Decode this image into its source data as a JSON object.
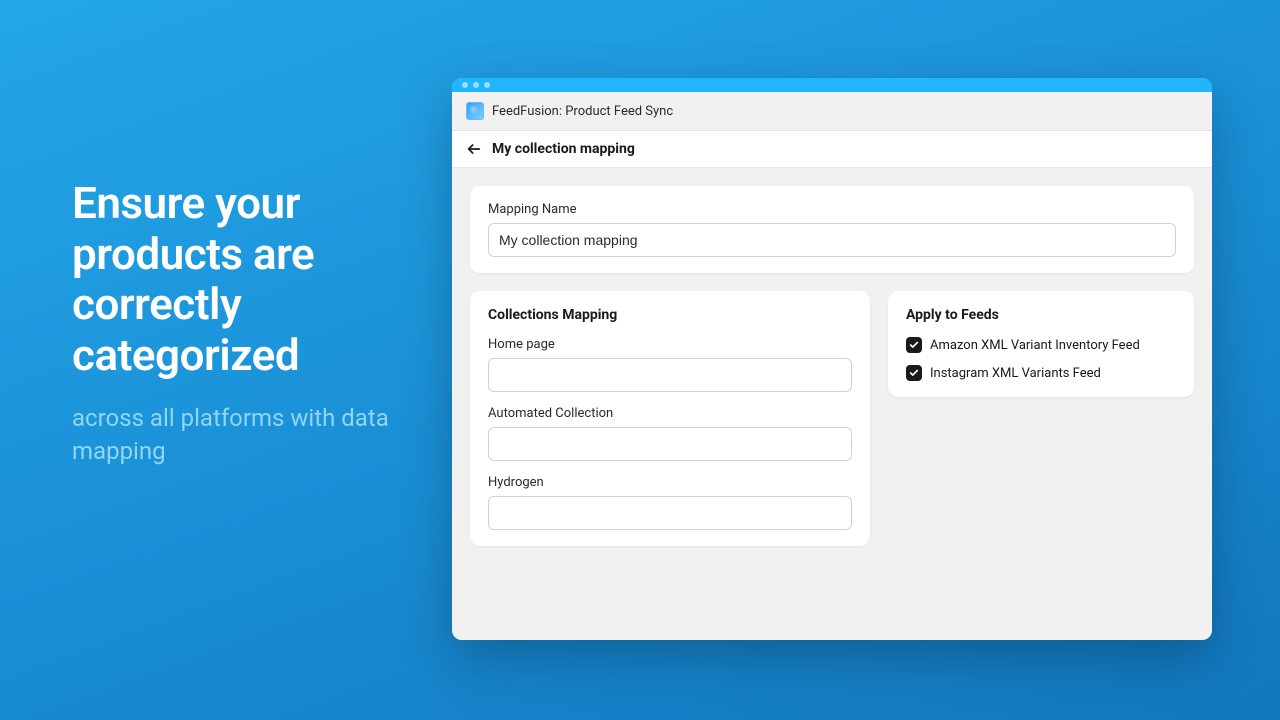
{
  "marketing": {
    "headline": "Ensure your products are correctly categorized",
    "subline": "across all platforms with data mapping"
  },
  "app": {
    "title": "FeedFusion: Product Feed Sync"
  },
  "page": {
    "title": "My collection mapping"
  },
  "mapping_name": {
    "label": "Mapping Name",
    "value": "My collection mapping"
  },
  "collections": {
    "title": "Collections Mapping",
    "items": [
      {
        "label": "Home page",
        "value": ""
      },
      {
        "label": "Automated Collection",
        "value": ""
      },
      {
        "label": "Hydrogen",
        "value": ""
      }
    ]
  },
  "feeds": {
    "title": "Apply to Feeds",
    "items": [
      {
        "label": "Amazon XML Variant Inventory Feed",
        "checked": true
      },
      {
        "label": "Instagram XML Variants Feed",
        "checked": true
      }
    ]
  }
}
